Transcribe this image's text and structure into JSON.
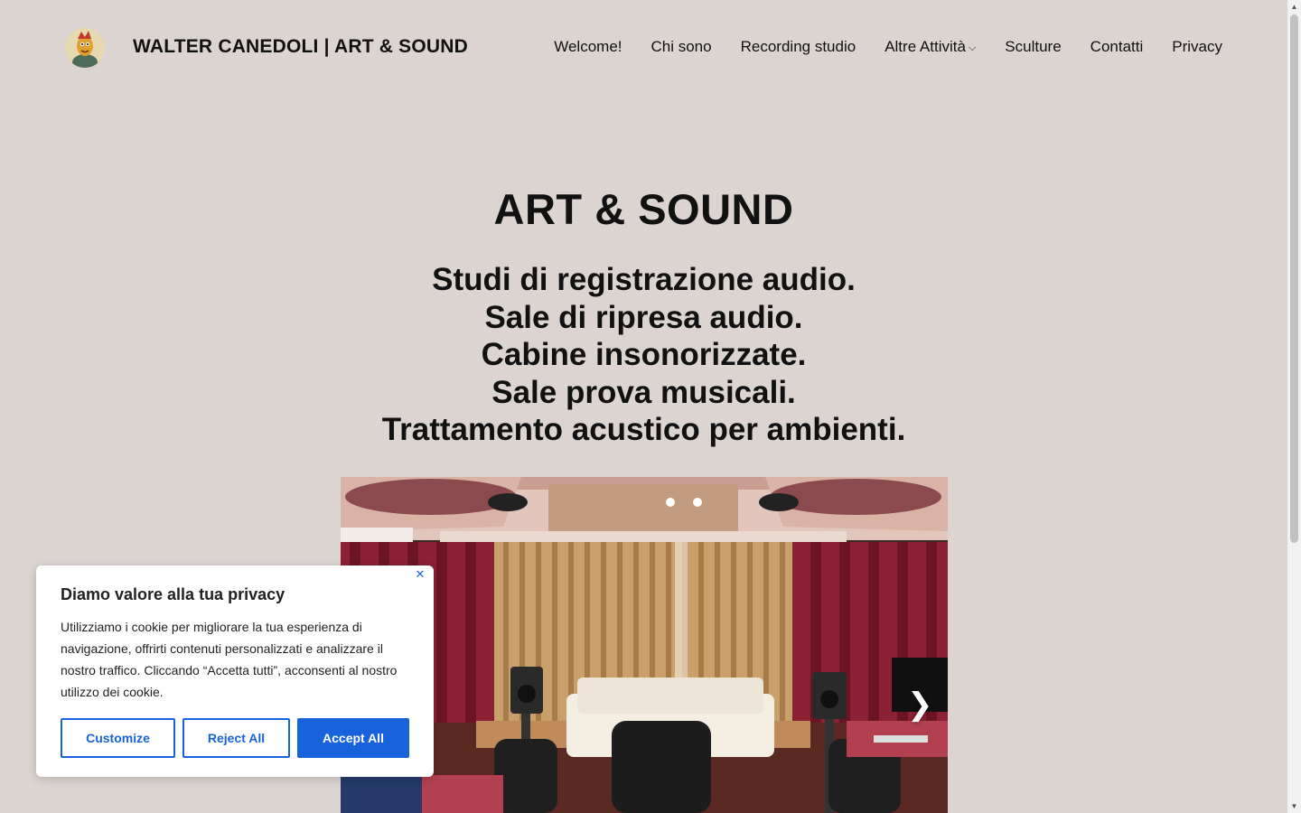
{
  "header": {
    "site_title": "WALTER CANEDOLI | ART & SOUND",
    "nav": [
      {
        "label": "Welcome!"
      },
      {
        "label": "Chi sono"
      },
      {
        "label": "Recording studio"
      },
      {
        "label": "Altre Attività",
        "has_dropdown": true
      },
      {
        "label": "Sculture"
      },
      {
        "label": "Contatti"
      },
      {
        "label": "Privacy"
      }
    ]
  },
  "hero": {
    "title": "ART & SOUND",
    "lines": [
      "Studi di registrazione audio.",
      "Sale di ripresa audio.",
      "Cabine insonorizzate.",
      "Sale prova musicali.",
      "Trattamento acustico per ambienti."
    ]
  },
  "slider": {
    "next_icon": "chevron-right-icon",
    "next_glyph": "❯"
  },
  "cookie_banner": {
    "title": "Diamo valore alla tua privacy",
    "text": "Utilizziamo i cookie per migliorare la tua esperienza di navigazione, offrirti contenuti personalizzati e analizzare il nostro traffico. Cliccando “Accetta tutti”, acconsenti al nostro utilizzo dei cookie.",
    "customize_label": "Customize",
    "reject_label": "Reject All",
    "accept_label": "Accept All",
    "close_icon": "close-icon",
    "close_glyph": "✕",
    "accent_color": "#1863dc"
  },
  "colors": {
    "page_background": "#dcd4d1",
    "text": "#111111"
  }
}
